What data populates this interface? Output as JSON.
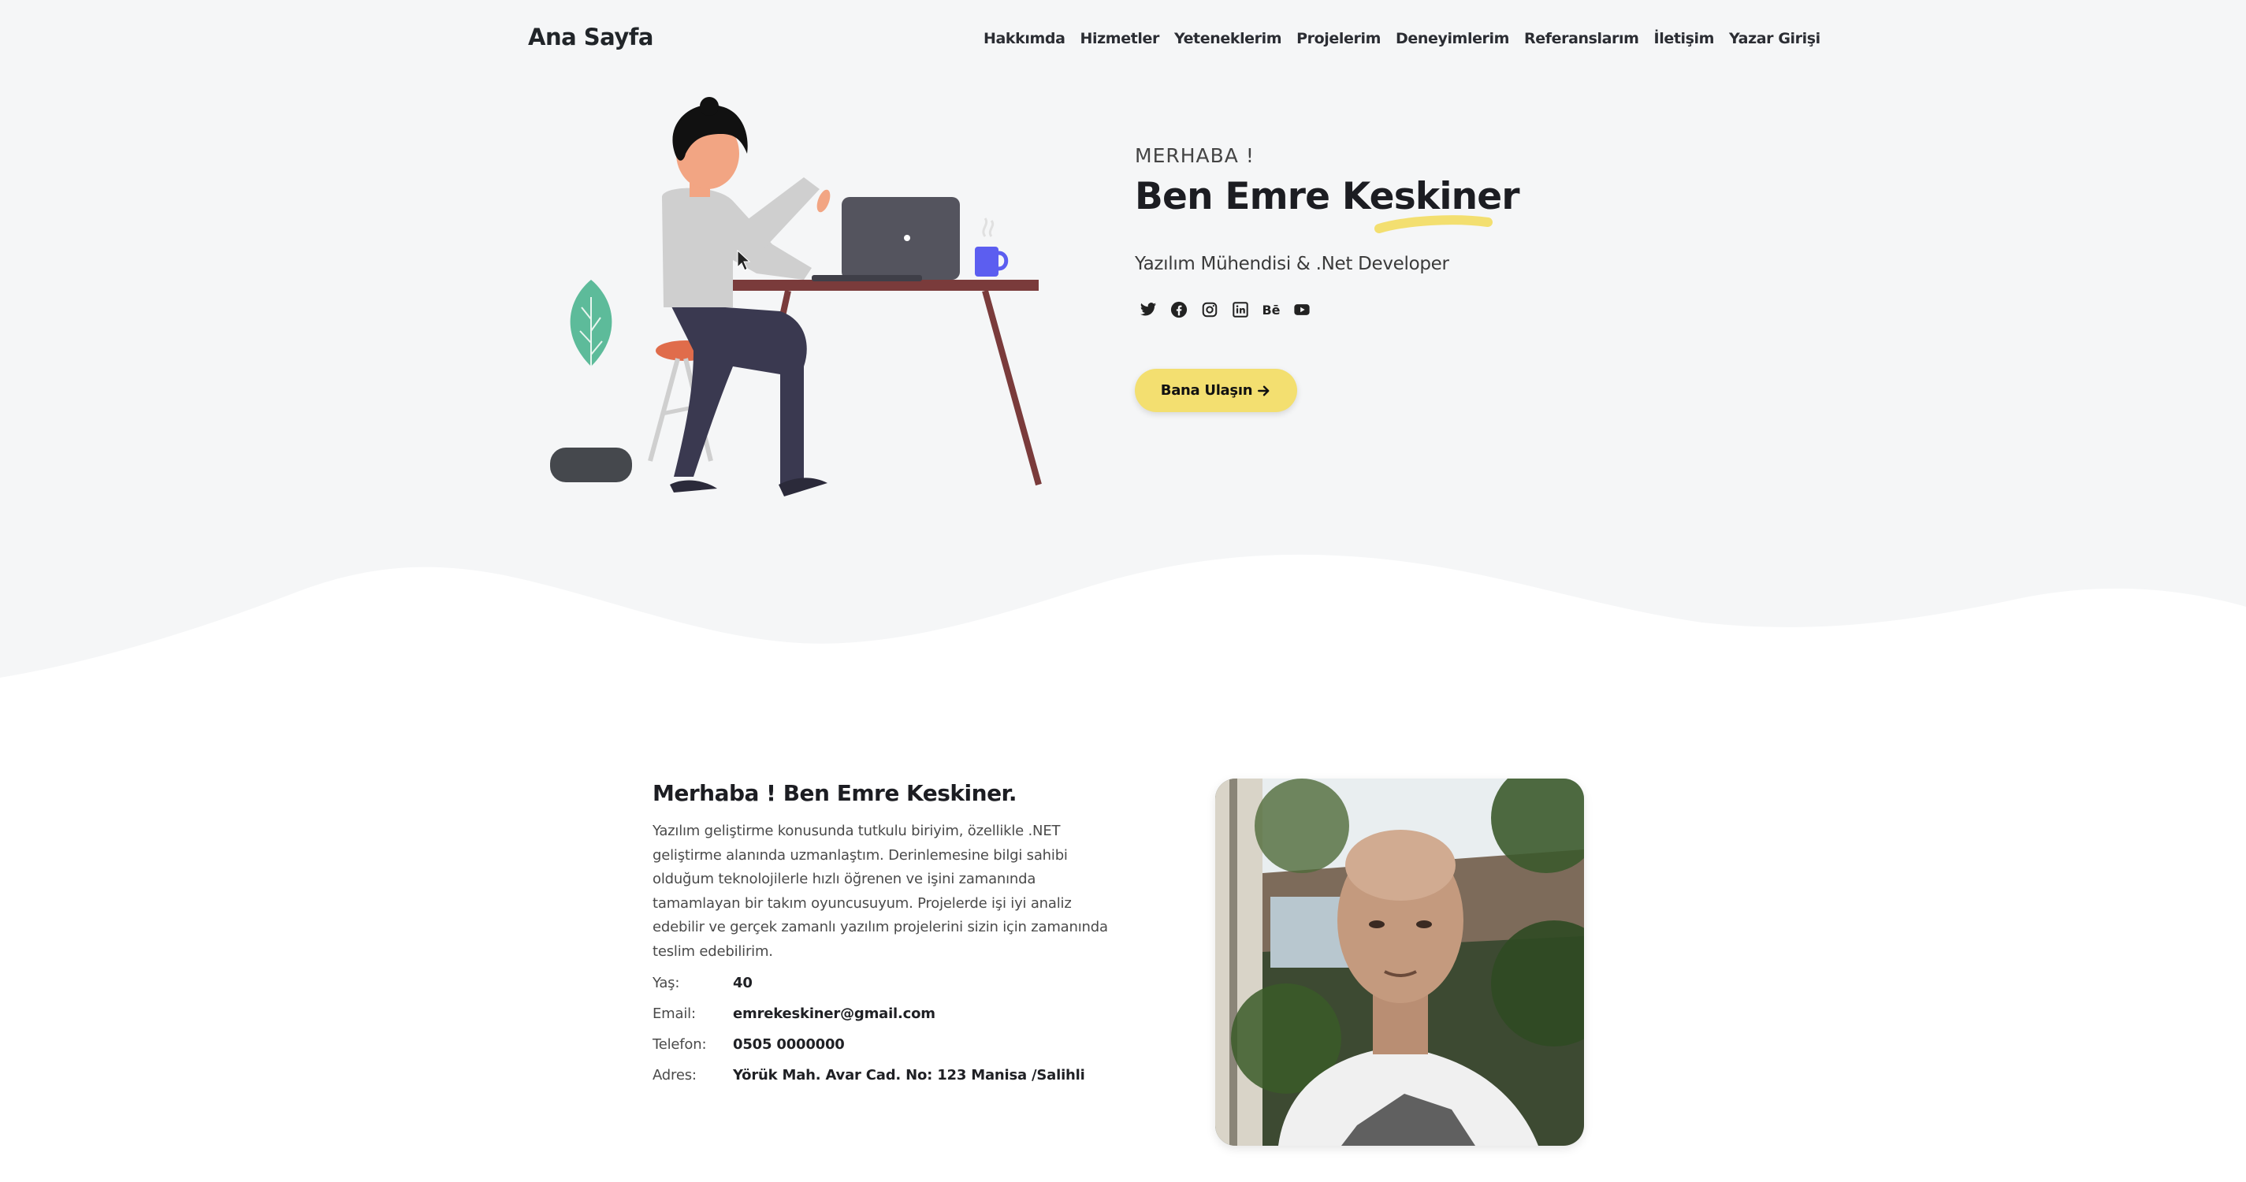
{
  "navbar": {
    "brand": "Ana Sayfa",
    "links": [
      "Hakkımda",
      "Hizmetler",
      "Yeteneklerim",
      "Projelerim",
      "Deneyimlerim",
      "Referanslarım",
      "İletişim",
      "Yazar Girişi"
    ]
  },
  "hero": {
    "greeting": "MERHABA !",
    "name": "Ben Emre Keskiner",
    "role": "Yazılım Mühendisi & .Net Developer",
    "socials": [
      "twitter-icon",
      "facebook-icon",
      "instagram-icon",
      "linkedin-icon",
      "behance-icon",
      "youtube-icon"
    ],
    "behance_label": "Bē",
    "cta_label": "Bana Ulaşın",
    "cta_icon": "arrow-right-icon",
    "accent_color": "#f3df70"
  },
  "about": {
    "title": "Merhaba ! Ben Emre Keskiner.",
    "text": "Yazılım geliştirme konusunda tutkulu biriyim, özellikle .NET geliştirme alanında uzmanlaştım. Derinlemesine bilgi sahibi olduğum teknolojilerle hızlı öğrenen ve işini zamanında tamamlayan bir takım oyuncusuyum. Projelerde işi iyi analiz edebilir ve gerçek zamanlı yazılım projelerini sizin için zamanında teslim edebilirim.",
    "info": [
      {
        "label": "Yaş:",
        "value": "40"
      },
      {
        "label": "Email:",
        "value": "emrekeskiner@gmail.com"
      },
      {
        "label": "Telefon:",
        "value": "0505 0000000"
      },
      {
        "label": "Adres:",
        "value": "Yörük Mah. Avar Cad. No: 123 Manisa /Salihli"
      }
    ]
  }
}
